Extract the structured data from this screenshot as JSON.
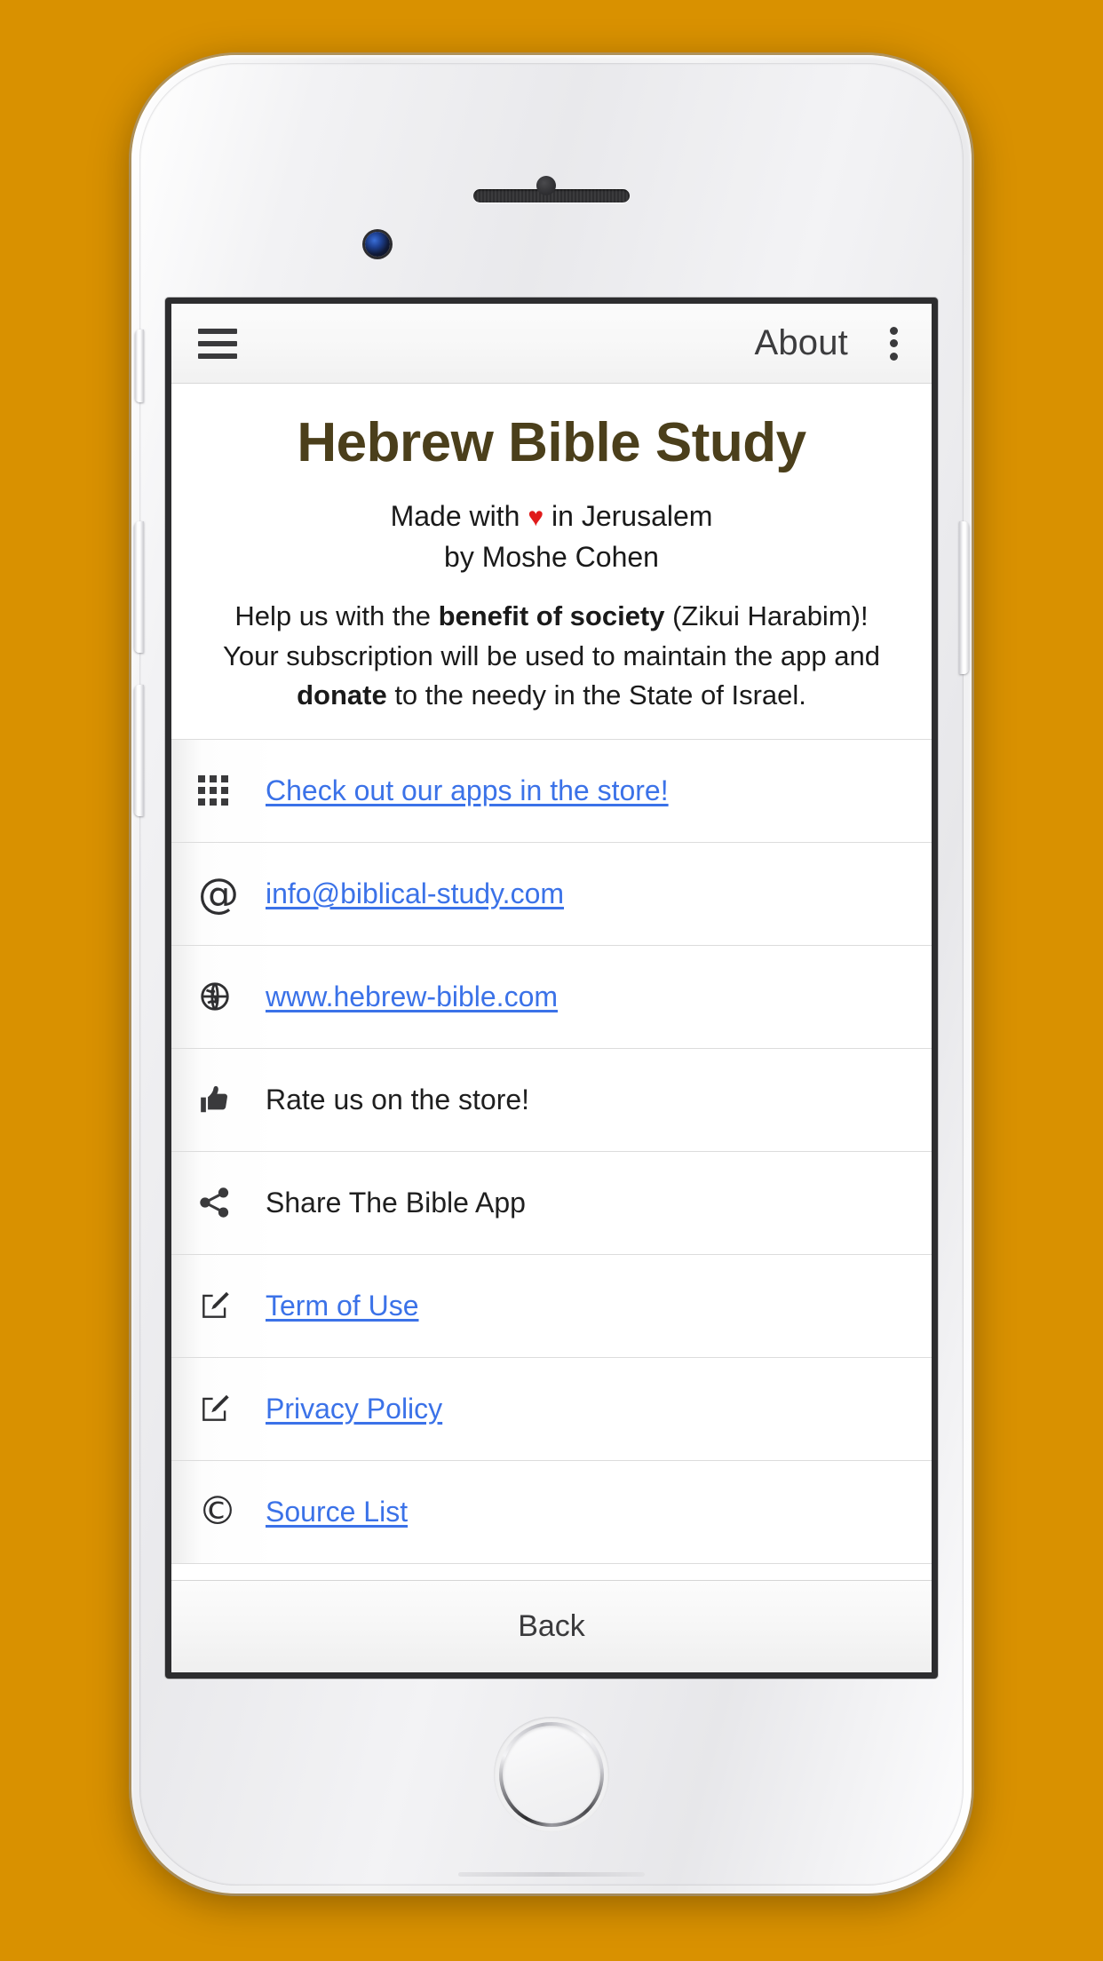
{
  "background_color": "#d99100",
  "device": {
    "frame_color": "#f0f0f2",
    "screen_border_color": "#2d2d2f"
  },
  "appbar": {
    "menu_icon": "hamburger-icon",
    "title": "About",
    "overflow_icon": "more-vertical-icon"
  },
  "intro": {
    "app_title": "Hebrew Bible Study",
    "made_with_prefix": "Made with ",
    "heart": "♥",
    "made_with_suffix": " in Jerusalem",
    "author_line": "by Moshe Cohen",
    "blurb_line1_a": "Help us with the ",
    "blurb_line1_b": "benefit of society",
    "blurb_line1_c": " (Zikui Harabim)!",
    "blurb_line2": "Your subscription will be used to maintain the app and",
    "blurb_line3_a": "donate",
    "blurb_line3_b": " to the needy in the State of Israel.",
    "title_color": "#4b3f1b",
    "heart_color": "#e01b1b"
  },
  "link_color": "#3b72e8",
  "list": {
    "items": [
      {
        "icon": "apps-grid-icon",
        "label": "Check out our apps in the store!",
        "is_link": true
      },
      {
        "icon": "at-sign-icon",
        "label": "info@biblical-study.com",
        "is_link": true
      },
      {
        "icon": "globe-icon",
        "label": "www.hebrew-bible.com",
        "is_link": true
      },
      {
        "icon": "thumbs-up-icon",
        "label": "Rate us on the store!",
        "is_link": false
      },
      {
        "icon": "share-icon",
        "label": "Share The Bible App",
        "is_link": false
      },
      {
        "icon": "edit-square-icon",
        "label": "Term of Use",
        "is_link": true
      },
      {
        "icon": "edit-square-icon",
        "label": "Privacy Policy",
        "is_link": true
      },
      {
        "icon": "copyright-icon",
        "label": "Source List",
        "is_link": true
      }
    ]
  },
  "footer": {
    "back_label": "Back"
  }
}
